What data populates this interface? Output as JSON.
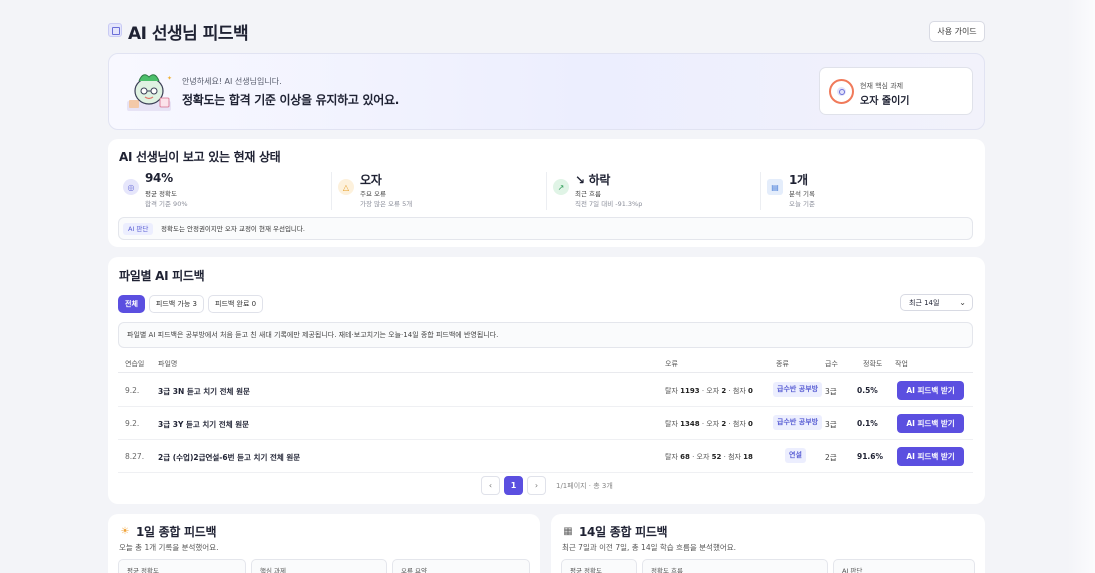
{
  "header": {
    "title": "AI 선생님 피드백",
    "guide_label": "사용 가이드"
  },
  "hero": {
    "greeting": "안녕하세요! AI 선생님입니다.",
    "message": "정확도는 합격 기준 이상을 유지하고 있어요.",
    "task_label": "현재 핵심 과제",
    "task_value": "오자 줄이기"
  },
  "status": {
    "title": "AI 선생님이 보고 있는 현재 상태",
    "metrics": [
      {
        "value": "94%",
        "label": "평균 정확도",
        "sub": "합격 기준 90%",
        "icon": "target-icon"
      },
      {
        "value": "오자",
        "label": "주요 오류",
        "sub": "가장 많은 오류 5개",
        "icon": "warning-icon"
      },
      {
        "value": "↘ 하락",
        "label": "최근 흐름",
        "sub": "직전 7일 대비 -91.3%p",
        "icon": "trend-icon"
      },
      {
        "value": "1개",
        "label": "분석 기록",
        "sub": "오늘 기준",
        "icon": "calendar-icon"
      }
    ],
    "judge_tag": "AI 판단",
    "judge_text": "정확도는 안정권이지만 오자 교정이 현재 우선입니다."
  },
  "files": {
    "title": "파일별 AI 피드백",
    "tabs": [
      {
        "label": "전체"
      },
      {
        "label": "피드백 가능 3"
      },
      {
        "label": "피드백 완료 0"
      }
    ],
    "range": "최근 14일",
    "notice": "파일별 AI 피드백은 공부방에서 처음 듣고 친 새대 기록에만 제공됩니다. 재테·보고치기는 오늘·14일 종합 피드백에 반영됩니다.",
    "columns": [
      "연습일",
      "파일명",
      "오류",
      "종류",
      "급수",
      "정확도",
      "작업"
    ],
    "rows": [
      {
        "date": "9.2.",
        "name": "3급 3N 듣고 치기 전체 원문",
        "err_a": "탈자 ",
        "err_a_v": "1193",
        "err_b": " · 오자 ",
        "err_b_v": "2",
        "err_c": " · 첨자 ",
        "err_c_v": "0",
        "type": "급수반 공부방",
        "grade": "3급",
        "acc": "0.5%",
        "btn": "AI 피드백 받기"
      },
      {
        "date": "9.2.",
        "name": "3급 3Y 듣고 치기 전체 원문",
        "err_a": "탈자 ",
        "err_a_v": "1348",
        "err_b": " · 오자 ",
        "err_b_v": "2",
        "err_c": " · 첨자 ",
        "err_c_v": "0",
        "type": "급수반 공부방",
        "grade": "3급",
        "acc": "0.1%",
        "btn": "AI 피드백 받기"
      },
      {
        "date": "8.27.",
        "name": "2급 (수업)2급연설-6번 듣고 치기 전체 원문",
        "err_a": "탈자 ",
        "err_a_v": "68",
        "err_b": " · 오자 ",
        "err_b_v": "52",
        "err_c": " · 첨자 ",
        "err_c_v": "18",
        "type": "연설",
        "grade": "2급",
        "acc": "91.6%",
        "btn": "AI 피드백 받기"
      }
    ],
    "pager": {
      "prev": "‹",
      "page": "1",
      "next": "›",
      "info": "1/1페이지 · 총 3개"
    }
  },
  "summary_day": {
    "icon": "☀",
    "title": "1일 종합 피드백",
    "desc": "오늘 총 1개 기록을 분석했어요.",
    "boxes": [
      "평균 정확도",
      "핵심 과제",
      "오류 요약"
    ]
  },
  "summary_14": {
    "icon": "▦",
    "title": "14일 종합 피드백",
    "desc": "최근 7일과 이전 7일, 총 14일 학습 흐름을 분석했어요.",
    "boxes": [
      "평균 정확도",
      "정확도 흐름",
      "AI 판단"
    ]
  },
  "colors": {
    "accent": "#5b4fe0",
    "tag_bg": "#eceefe",
    "ring": "#f07a5a"
  }
}
